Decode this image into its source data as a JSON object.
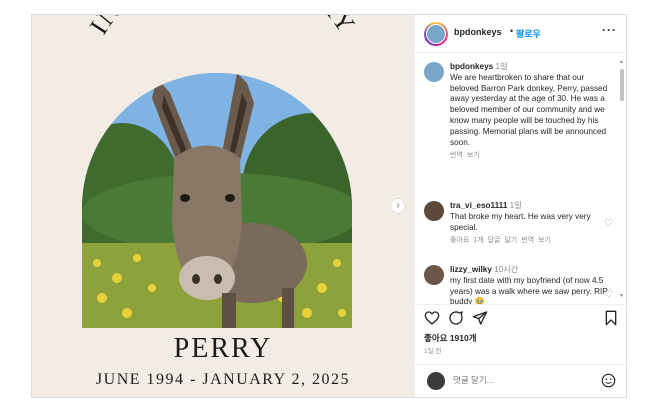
{
  "post": {
    "memorial_heading": "IN LOVING MEMORY",
    "name": "PERRY",
    "dates": "JUNE 1994 - JANUARY 2, 2025"
  },
  "header": {
    "username": "bpdonkeys",
    "separator": "•",
    "follow_label": "팔로우",
    "more_label": "···"
  },
  "caption": {
    "username": "bpdonkeys",
    "time": "1일",
    "text": "We are heartbroken to share that our beloved Barron Park donkey, Perry, passed away yesterday at the age of 30. He was a beloved member of our community and we know many people will be touched by his passing. Memorial plans will be announced soon.",
    "translate": "번역 보기"
  },
  "comments": [
    {
      "username": "tra_vi_eso1111",
      "time": "1일",
      "text": "That broke my heart. He was very very special.",
      "meta": "좋아요 1개  답글 달기  번역 보기"
    },
    {
      "username": "lizzy_wilky",
      "time": "10시간",
      "text": "my first date with my boyfriend (of now 4.5 years) was a walk where we saw perry. RIP buddy 🥹"
    }
  ],
  "actions": {
    "likes": "좋아요 1910개",
    "date": "1일 전"
  },
  "add_comment": {
    "placeholder": "댓글 달기..."
  },
  "colors": {
    "accent": "#0095f6",
    "text": "#262626",
    "muted": "#8e8e8e",
    "card_bg": "#f3ece4"
  }
}
